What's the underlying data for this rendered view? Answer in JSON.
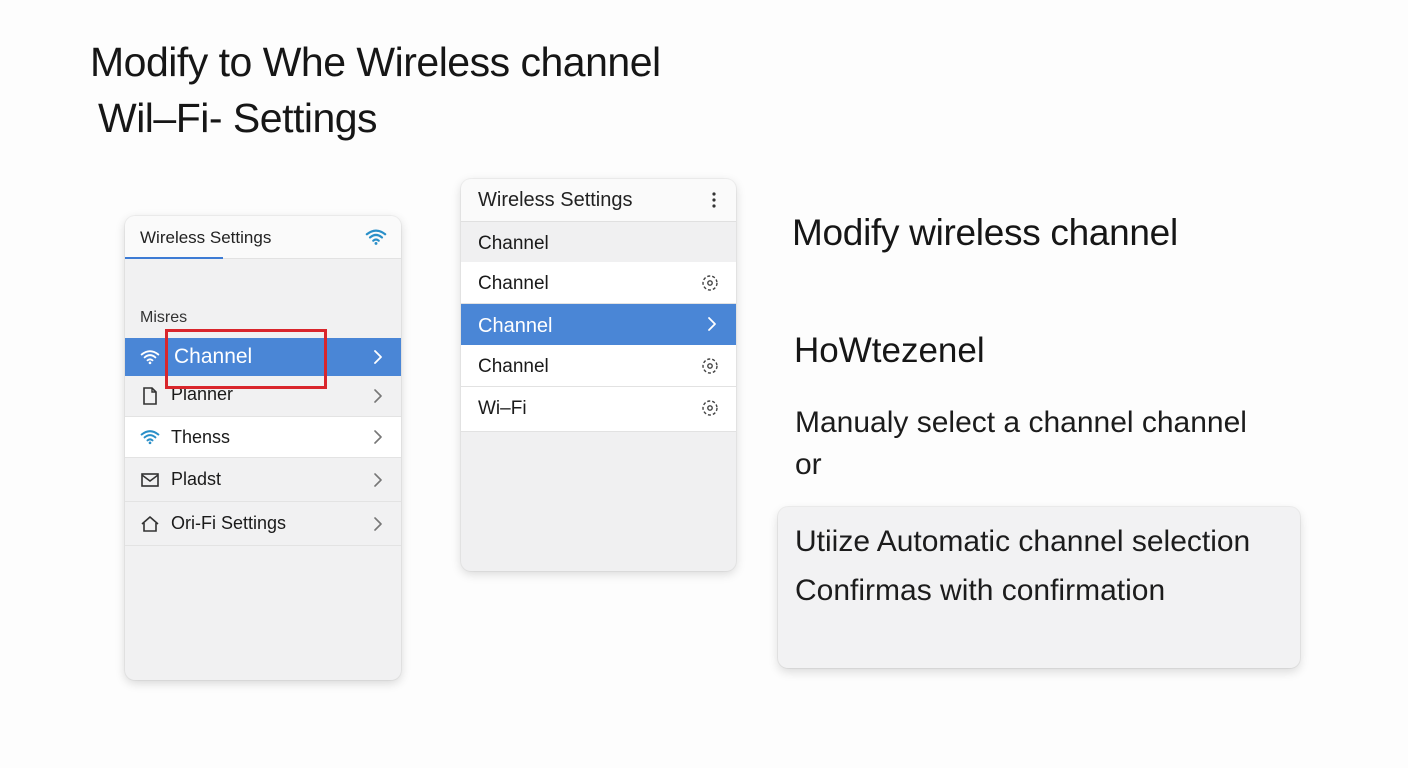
{
  "page_title": {
    "line1": "Modify to Whe Wireless channel",
    "line2": "Wil–Fi- Settings"
  },
  "left_panel": {
    "header_title": "Wireless Settings",
    "header_icon": "wifi-icon",
    "section_label": "Misres",
    "items": [
      {
        "label": "Channel",
        "icon": "wifi-icon",
        "selected": true
      },
      {
        "label": "Planner",
        "icon": "document-icon",
        "selected": false
      },
      {
        "label": "Thenss",
        "icon": "wifi-icon",
        "selected": false
      },
      {
        "label": "Pladst",
        "icon": "mail-icon",
        "selected": false
      },
      {
        "label": "Ori-Fi Settings",
        "icon": "home-icon",
        "selected": false
      }
    ]
  },
  "middle_panel": {
    "header_title": "Wireless Settings",
    "items": [
      {
        "label": "Channel",
        "icon": ""
      },
      {
        "label": "Channel",
        "icon": "gear-icon"
      },
      {
        "label": "Channel",
        "icon": "chevron-right-icon",
        "selected": true
      },
      {
        "label": "Channel",
        "icon": "gear-icon"
      },
      {
        "label": "Wi–Fi",
        "icon": "gear-icon"
      }
    ]
  },
  "right_panel": {
    "heading": "Modify wireless channel",
    "subheading": "HoWtezenel",
    "description_line1": "Manualy select a channel channel",
    "description_line2": "or",
    "box_line1": "Utiize Automatic channel selection",
    "box_line2": "Confirmas with confirmation"
  },
  "colors": {
    "accent": "#4a86d6",
    "highlight": "#d9262c",
    "wifi_icon": "#2a8fc8"
  }
}
